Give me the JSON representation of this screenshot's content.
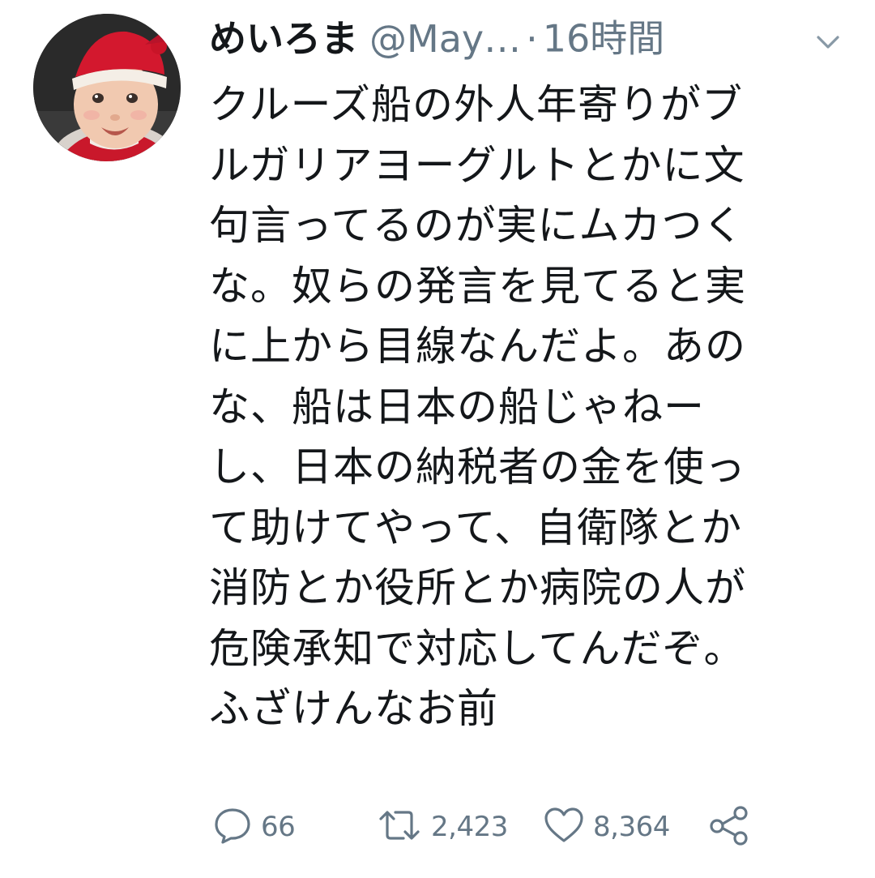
{
  "user": {
    "display_name": "めいろま",
    "handle": "@May…",
    "separator": "·",
    "timestamp": "16時間",
    "avatar_icon": "baby-santa-hat-avatar"
  },
  "tweet": {
    "lines": [
      "クルーズ船の外人年寄りがブ",
      "ルガリアヨーグルトとかに文",
      "句言ってるのが実にムカつく",
      "な。奴らの発言を見てると実",
      "に上から目線なんだよ。あの",
      "な、船は日本の船じゃねー",
      "し、日本の納税者の金を使っ",
      "て助けてやって、自衛隊とか",
      "消防とか役所とか病院の人が",
      "危険承知で対応してんだぞ。",
      "ふざけんなお前"
    ]
  },
  "actions": {
    "reply": {
      "icon": "reply-bubble-icon",
      "count": "66"
    },
    "retweet": {
      "icon": "retweet-icon",
      "count": "2,423"
    },
    "like": {
      "icon": "heart-icon",
      "count": "8,364"
    },
    "share": {
      "icon": "share-icon"
    }
  },
  "menu": {
    "icon": "chevron-down-icon"
  },
  "colors": {
    "text": "#14171a",
    "muted": "#657786",
    "background": "#ffffff"
  }
}
